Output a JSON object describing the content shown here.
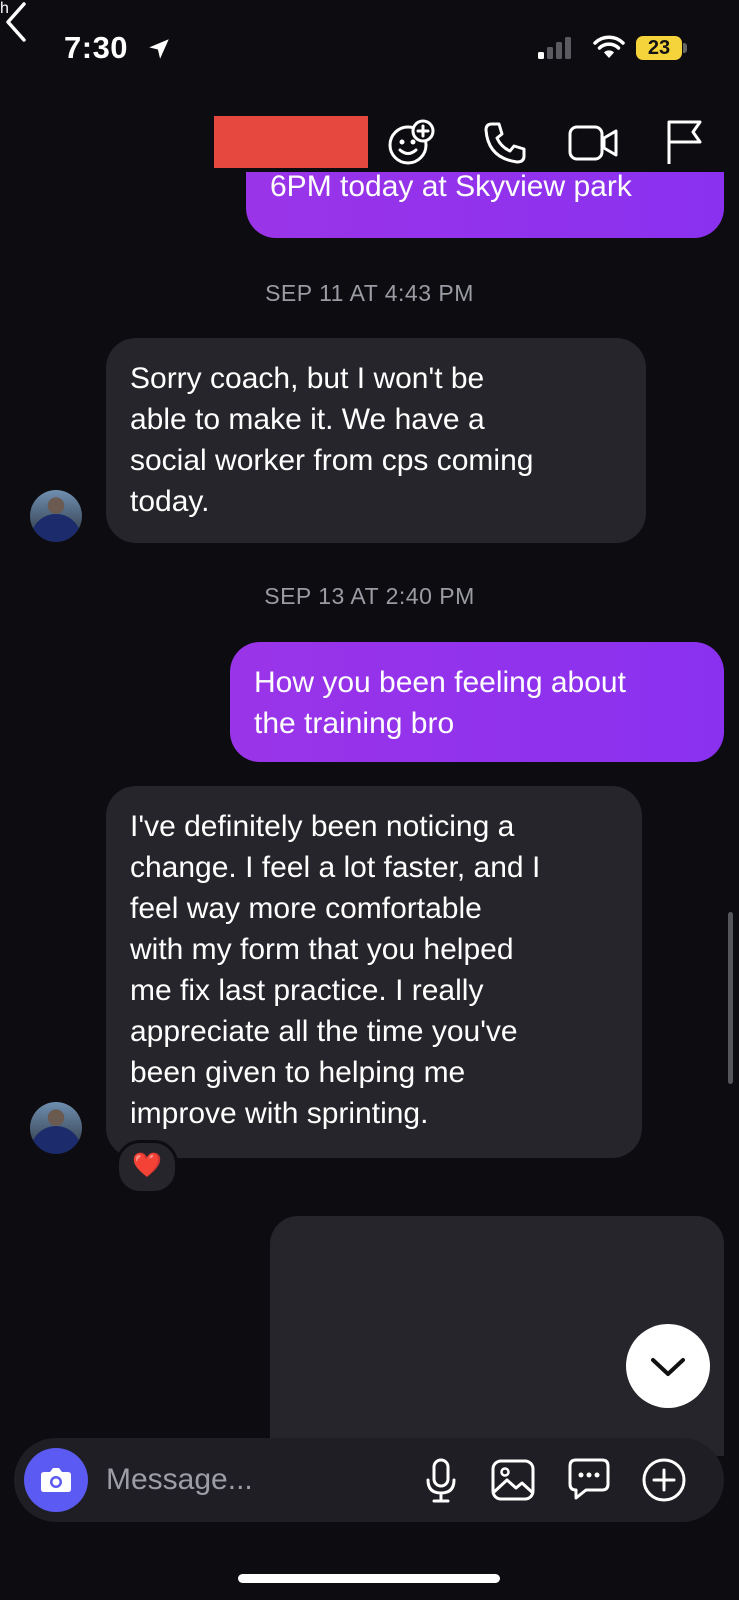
{
  "status_bar": {
    "time": "7:30",
    "battery": "23"
  },
  "header": {
    "contact_name_visible": "h"
  },
  "messages": [
    {
      "type": "out",
      "text": "6PM today at Skyview park"
    },
    {
      "type": "timestamp",
      "text": "SEP 11 AT 4:43 PM"
    },
    {
      "type": "in",
      "lines": [
        "Sorry coach, but I won't be",
        "able to make it. We have a",
        "social worker from cps coming",
        "today."
      ]
    },
    {
      "type": "timestamp",
      "text": "SEP 13 AT 2:40 PM"
    },
    {
      "type": "out",
      "lines": [
        "How you been feeling about",
        "the training bro"
      ]
    },
    {
      "type": "in",
      "lines": [
        "I've definitely been noticing a",
        "change. I feel a lot faster, and I",
        "feel way more comfortable",
        "with my form that you helped",
        "me fix last practice. I really",
        "appreciate all the time you've",
        "been given to helping me",
        "improve with sprinting."
      ],
      "reaction": "❤️"
    }
  ],
  "composer": {
    "placeholder": "Message..."
  },
  "icons": {
    "status": [
      "location-arrow-icon",
      "signal-icon",
      "wifi-icon",
      "battery-icon"
    ],
    "header": [
      "back-chevron-icon",
      "effects-icon",
      "phone-icon",
      "video-icon",
      "flag-icon"
    ],
    "composer": [
      "camera-icon",
      "microphone-icon",
      "gallery-icon",
      "chat-bubble-icon",
      "plus-circle-icon"
    ],
    "misc": [
      "chevron-down-icon"
    ]
  },
  "colors": {
    "background": "#0c0c11",
    "incoming_bubble": "#25252b",
    "outgoing_bubble": "#9a34e8",
    "camera_button": "#5b5bf3",
    "battery": "#f5d33a",
    "redaction": "#e6473f"
  }
}
